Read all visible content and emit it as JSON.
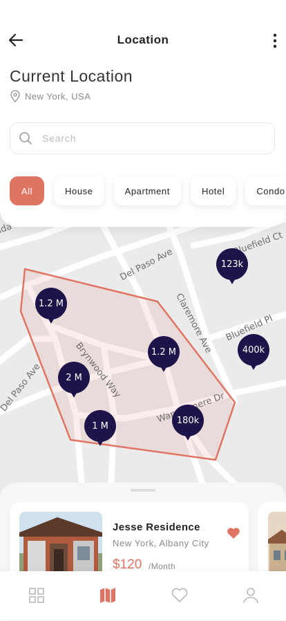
{
  "header": {
    "title": "Location"
  },
  "location": {
    "heading": "Current Location",
    "city": "New York, USA"
  },
  "search": {
    "placeholder": "Search",
    "value": ""
  },
  "filters": [
    {
      "label": "All",
      "active": true
    },
    {
      "label": "House",
      "active": false
    },
    {
      "label": "Apartment",
      "active": false
    },
    {
      "label": "Hotel",
      "active": false
    },
    {
      "label": "Condo",
      "active": false
    }
  ],
  "map": {
    "streets": [
      "Del Paso Ave",
      "Claremore Ave",
      "Bluefield Ct",
      "Bluefield Pl",
      "Brynwood Way",
      "Wandermere Dr",
      "Del Paso Ave",
      "ada"
    ],
    "pins": [
      "123k",
      "1.2 M",
      "1.2 M",
      "400k",
      "2 M",
      "1 M",
      "180k"
    ],
    "polygon_color": "#e07463"
  },
  "listing": {
    "name": "Jesse Residence",
    "address": "New York, Albany City",
    "price": "$120",
    "period": "/Month",
    "favorite": true
  },
  "nav": {
    "items": [
      "grid-icon",
      "map-icon",
      "heart-icon",
      "profile-icon"
    ],
    "active": "map-icon",
    "accent": "#e07463"
  },
  "colors": {
    "accent": "#e07463",
    "pin": "#1d1449"
  }
}
